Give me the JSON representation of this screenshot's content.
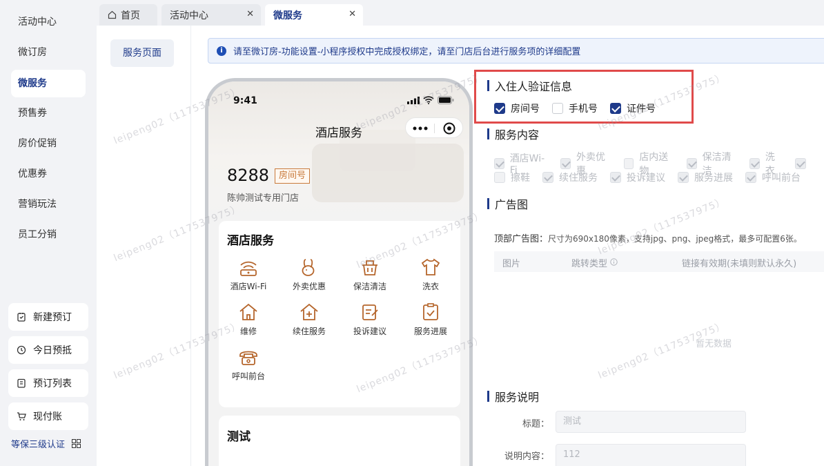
{
  "sidebar": {
    "items": [
      {
        "label": "活动中心"
      },
      {
        "label": "微订房"
      },
      {
        "label": "微服务",
        "active": true
      },
      {
        "label": "预售券"
      },
      {
        "label": "房价促销"
      },
      {
        "label": "优惠券"
      },
      {
        "label": "营销玩法"
      },
      {
        "label": "员工分销"
      }
    ],
    "quick": [
      {
        "label": "新建预订",
        "icon": "calendar-check-icon"
      },
      {
        "label": "今日预抵",
        "icon": "clock-icon"
      },
      {
        "label": "预订列表",
        "icon": "list-icon"
      },
      {
        "label": "现付账",
        "icon": "cart-icon"
      }
    ],
    "cert_label": "等保三级认证"
  },
  "tabs": [
    {
      "label": "首页",
      "icon": "home-icon"
    },
    {
      "label": "活动中心",
      "closable": true
    },
    {
      "label": "微服务",
      "closable": true,
      "active": true
    }
  ],
  "subnav": {
    "label": "服务页面"
  },
  "notice": {
    "text": "请至微订房-功能设置-小程序授权中完成授权绑定，请至门店后台进行服务项的详细配置"
  },
  "phone": {
    "time": "9:41",
    "title": "酒店服务",
    "room_number": "8288",
    "room_tag": "房间号",
    "store_name": "陈帅测试专用门店",
    "card_title": "酒店服务",
    "services": [
      {
        "label": "酒店Wi-Fi",
        "icon": "wifi-icon"
      },
      {
        "label": "外卖优惠",
        "icon": "rabbit-icon"
      },
      {
        "label": "保洁清洁",
        "icon": "basket-icon"
      },
      {
        "label": "洗衣",
        "icon": "shirt-icon"
      },
      {
        "label": "维修",
        "icon": "house-repair-icon"
      },
      {
        "label": "续住服务",
        "icon": "house-plus-icon"
      },
      {
        "label": "投诉建议",
        "icon": "edit-icon"
      },
      {
        "label": "服务进展",
        "icon": "clipboard-check-icon"
      },
      {
        "label": "呼叫前台",
        "icon": "telephone-icon"
      }
    ],
    "card2_title": "测试"
  },
  "verify": {
    "title": "入住人验证信息",
    "options": [
      {
        "label": "房间号",
        "checked": true
      },
      {
        "label": "手机号",
        "checked": false
      },
      {
        "label": "证件号",
        "checked": true
      }
    ]
  },
  "content": {
    "title": "服务内容",
    "row1": [
      {
        "label": "酒店Wi-Fi",
        "checked": true
      },
      {
        "label": "外卖优惠",
        "checked": true
      },
      {
        "label": "店内送物",
        "checked": false
      },
      {
        "label": "保洁清洁",
        "checked": true
      },
      {
        "label": "洗衣",
        "checked": true
      },
      {
        "label": "",
        "checked": true
      }
    ],
    "row2": [
      {
        "label": "擦鞋",
        "checked": false
      },
      {
        "label": "续住服务",
        "checked": true
      },
      {
        "label": "投诉建议",
        "checked": true
      },
      {
        "label": "服务进展",
        "checked": true
      },
      {
        "label": "呼叫前台",
        "checked": true
      }
    ]
  },
  "ad": {
    "title": "广告图",
    "label": "顶部广告图：",
    "hint": "尺寸为690x180像素，支持jpg、png、jpeg格式，最多可配置6张。",
    "columns": [
      "图片",
      "跳转类型",
      "链接有效期(未填则默认永久)"
    ],
    "empty": "暂无数据"
  },
  "desc": {
    "title": "服务说明",
    "title_label": "标题：",
    "title_value": "测试",
    "content_label": "说明内容：",
    "content_value": "112"
  },
  "watermark": "leipeng02（11753797​5）"
}
